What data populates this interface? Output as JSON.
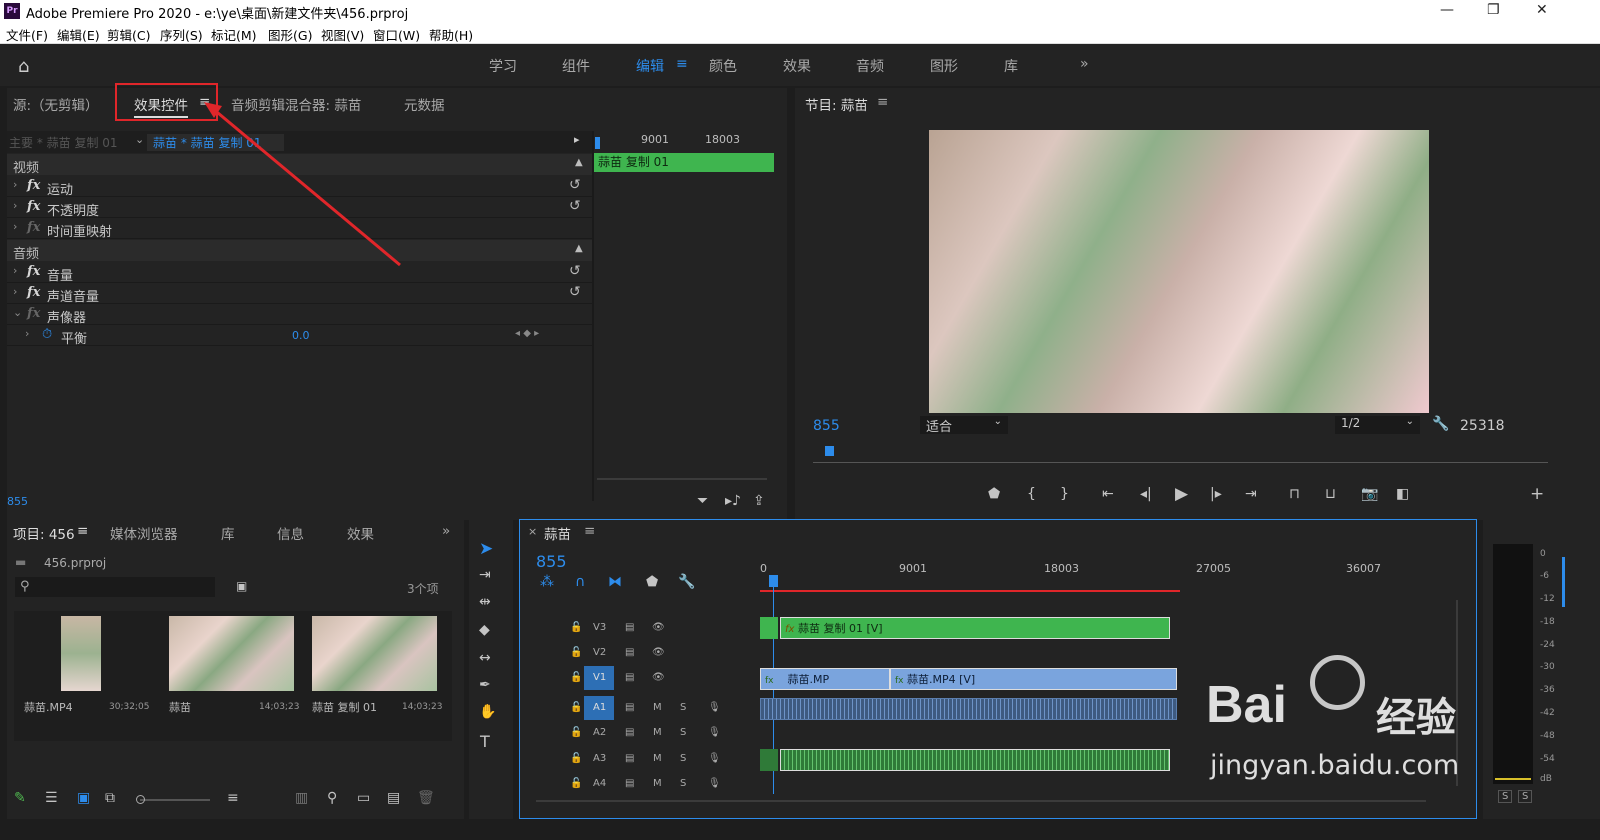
{
  "window": {
    "title": "Adobe Premiere Pro 2020 - e:\\ye\\桌面\\新建文件夹\\456.prproj",
    "app_icon": "Pr"
  },
  "menu": [
    "文件(F)",
    "编辑(E)",
    "剪辑(C)",
    "序列(S)",
    "标记(M)",
    "图形(G)",
    "视图(V)",
    "窗口(W)",
    "帮助(H)"
  ],
  "workspaces": {
    "items": [
      "学习",
      "组件",
      "编辑",
      "颜色",
      "效果",
      "音频",
      "图形",
      "库"
    ],
    "active": "编辑",
    "more": "»"
  },
  "source_panel": {
    "tabs": [
      "源:（无剪辑）",
      "效果控件",
      "音频剪辑混合器: 蒜苗",
      "元数据"
    ],
    "active_tab": "效果控件",
    "master_label": "主要 * 蒜苗 复制 01",
    "clip_label": "蒜苗 * 蒜苗 复制 01",
    "ruler": [
      "9001",
      "18003"
    ],
    "clip_bar": "蒜苗 复制 01",
    "sections": {
      "video": "视频",
      "audio": "音频"
    },
    "effects": [
      "运动",
      "不透明度",
      "时间重映射",
      "音量",
      "声道音量",
      "声像器"
    ],
    "balance": {
      "label": "平衡",
      "value": "0.0"
    },
    "timecode": "855"
  },
  "program_monitor": {
    "title": "节目: 蒜苗",
    "timecode": "855",
    "fit": "适合",
    "resolution": "1/2",
    "duration": "25318"
  },
  "project_panel": {
    "tabs": [
      "项目: 456",
      "媒体浏览器",
      "库",
      "信息",
      "效果"
    ],
    "file": "456.prproj",
    "count": "3个项",
    "items": [
      {
        "name": "蒜苗.MP4",
        "duration": "30;32;05"
      },
      {
        "name": "蒜苗",
        "duration": "14;03;23"
      },
      {
        "name": "蒜苗 复制 01",
        "duration": "14;03;23"
      }
    ]
  },
  "timeline": {
    "title": "蒜苗",
    "timecode": "855",
    "ruler": [
      "0",
      "9001",
      "18003",
      "27005",
      "36007"
    ],
    "tracks": [
      "V3",
      "V2",
      "V1",
      "A1",
      "A2",
      "A3",
      "A4"
    ],
    "clips": {
      "v3": "蒜苗 复制 01 [V]",
      "v1a": "蒜苗.MP",
      "v1b": "蒜苗.MP4 [V]"
    },
    "track_buttons": {
      "mute": "M",
      "solo": "S"
    }
  },
  "meters": {
    "scale": [
      "0",
      "-6",
      "-12",
      "-18",
      "-24",
      "-30",
      "-36",
      "-42",
      "-48",
      "-54",
      "dB"
    ],
    "solo": [
      "S",
      "S"
    ]
  },
  "watermark": {
    "brand": "Bai",
    "brand2": "经验",
    "url": "jingyan.baidu.com"
  },
  "colors": {
    "accent": "#2d8ceb",
    "clip_green": "#3fb54f",
    "clip_blue": "#7aa4dd",
    "annotation": "#e0262a"
  }
}
